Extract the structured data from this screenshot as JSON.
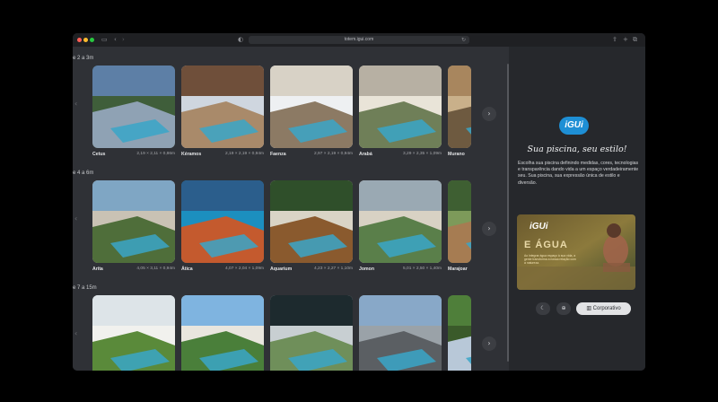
{
  "browser": {
    "url": "totem.igui.com"
  },
  "sections": [
    {
      "label": "e 2 a 3m",
      "cards": [
        {
          "name": "Cetus",
          "dims": "2,19 × 2,11 × 0,86m"
        },
        {
          "name": "Kéramos",
          "dims": "2,19 × 2,19 × 0,94m"
        },
        {
          "name": "Faenza",
          "dims": "2,97 × 2,19 × 0,94m"
        },
        {
          "name": "Arabá",
          "dims": "3,29 × 2,35 × 1,09m"
        },
        {
          "name": "Murano",
          "dims": ""
        }
      ]
    },
    {
      "label": "e 4 a 6m",
      "cards": [
        {
          "name": "Arita",
          "dims": "4,05 × 3,11 × 0,94m"
        },
        {
          "name": "Ática",
          "dims": "4,07 × 2,04 × 1,09m"
        },
        {
          "name": "Aquarium",
          "dims": "4,23 × 2,27 × 1,10m"
        },
        {
          "name": "Jomon",
          "dims": "5,01 × 2,50 × 1,40m"
        },
        {
          "name": "Marajoar",
          "dims": ""
        }
      ]
    },
    {
      "label": "e 7 a 15m",
      "cards": [
        {
          "name": "",
          "dims": ""
        },
        {
          "name": "",
          "dims": ""
        },
        {
          "name": "",
          "dims": ""
        },
        {
          "name": "",
          "dims": ""
        },
        {
          "name": "",
          "dims": ""
        }
      ]
    }
  ],
  "panel": {
    "logo": "iGUi",
    "tagline": "Sua piscina, seu estilo!",
    "description": "Escolha sua piscina definindo medidas, cores, tecnologias e transparência dando vida a um espaço verdadeiramente seu. Sua piscina, sua expressão única de estilo e diversão.",
    "promo": {
      "logo": "iGUi",
      "title": "E ÁGUA",
      "body": "Ao integrar água espaço à sua vida, a gente transforma a nossa relação com a natureza."
    },
    "controls": {
      "theme_icon": "moon-icon",
      "language_icon": "globe-icon",
      "corporate_label": "Corporativo"
    }
  },
  "colors": {
    "brand_blue": "#1e8fd5",
    "background": "#2f3136",
    "panel": "#26282c"
  }
}
